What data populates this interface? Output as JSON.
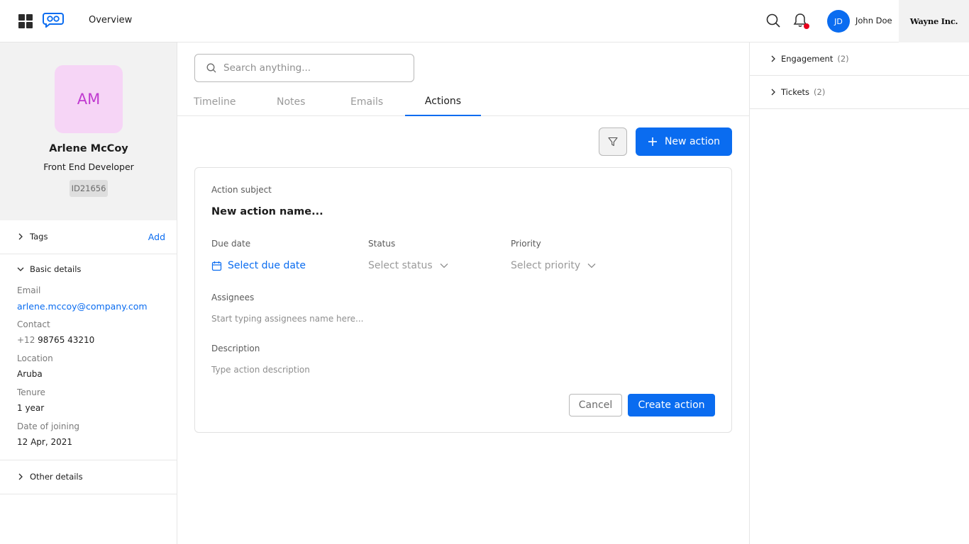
{
  "topbar": {
    "nav_title": "Overview",
    "user_initials": "JD",
    "user_name": "John Doe",
    "company": "Wayne Inc.",
    "notification_dot_color": "#e8001c"
  },
  "profile": {
    "initials": "AM",
    "name": "Arlene McCoy",
    "role": "Front End Developer",
    "id": "ID21656"
  },
  "sidebar": {
    "tags_label": "Tags",
    "add_label": "Add",
    "basic_details_label": "Basic details",
    "fields": [
      {
        "label": "Email",
        "value": "arlene.mccoy@company.com"
      },
      {
        "label": "Contact",
        "prefix": "+12",
        "value": "98765 43210"
      },
      {
        "label": "Location",
        "value": "Aruba"
      },
      {
        "label": "Tenure",
        "value": "1 year"
      },
      {
        "label": "Date of joining",
        "value": "12 Apr, 2021"
      }
    ],
    "other_details_label": "Other details"
  },
  "main": {
    "search_placeholder": "Search anything...",
    "tabs": [
      {
        "label": "Timeline",
        "active": false
      },
      {
        "label": "Notes",
        "active": false
      },
      {
        "label": "Emails",
        "active": false
      },
      {
        "label": "Actions",
        "active": true
      }
    ],
    "new_action_label": "New action"
  },
  "action_form": {
    "subject_label": "Action subject",
    "subject_placeholder": "New action name...",
    "due_date_label": "Due date",
    "due_date_value": "Select due date",
    "status_label": "Status",
    "status_value": "Select status",
    "priority_label": "Priority",
    "priority_value": "Select priority",
    "assignees_label": "Assignees",
    "assignees_placeholder": "Start typing assignees name here...",
    "description_label": "Description",
    "description_placeholder": "Type action description",
    "cancel_label": "Cancel",
    "create_label": "Create action"
  },
  "right_panel": {
    "sections": [
      {
        "label": "Engagement",
        "count": "(2)"
      },
      {
        "label": "Tickets",
        "count": "(2)"
      }
    ]
  },
  "colors": {
    "accent": "#0a6cf0",
    "avatar_bg": "#f6d5f6",
    "avatar_text": "#c03ad0"
  }
}
